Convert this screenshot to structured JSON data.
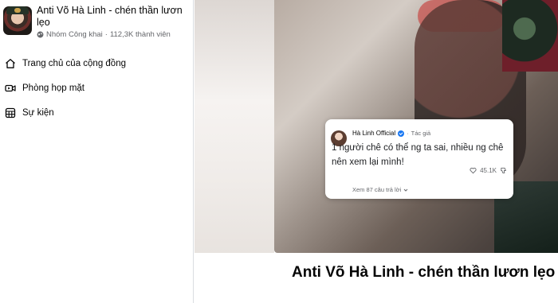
{
  "group": {
    "title": "Anti Võ Hà Linh - chén thần lươn lẹo",
    "privacy": "Nhóm Công khai",
    "separator": "·",
    "members": "112,3K thành viên"
  },
  "nav": {
    "items": [
      {
        "label": "Trang chủ của cộng đồng",
        "icon": "home-icon"
      },
      {
        "label": "Phòng họp mặt",
        "icon": "video-icon"
      },
      {
        "label": "Sự kiện",
        "icon": "calendar-icon"
      }
    ]
  },
  "media": {
    "comment": {
      "author": "Hà Linh Official",
      "badge": "Tác giả",
      "bullet": "·",
      "text": "1 người chê có thể ng ta sai, nhiều ng chê nên xem lại mình!",
      "likes": "45.1K",
      "replies": "Xem 87 câu trả lời"
    }
  },
  "post": {
    "title": "Anti Võ Hà Linh - chén thần lươn lẹo"
  }
}
